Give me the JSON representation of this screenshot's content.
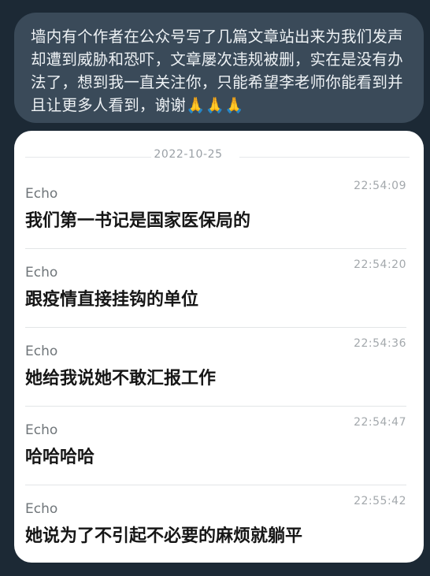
{
  "bubble": {
    "text": "墙内有个作者在公众号写了几篇文章站出来为我们发声却遭到威胁和恐吓，文章屡次违规被删，实在是没有办法了，想到我一直关注你，只能希望李老师你能看到并且让更多人看到，谢谢🙏🙏🙏"
  },
  "chat": {
    "date": "2022-10-25",
    "messages": [
      {
        "sender": "Echo",
        "time": "22:54:09",
        "text": "我们第一书记是国家医保局的"
      },
      {
        "sender": "Echo",
        "time": "22:54:20",
        "text": "跟疫情直接挂钩的单位"
      },
      {
        "sender": "Echo",
        "time": "22:54:36",
        "text": "她给我说她不敢汇报工作"
      },
      {
        "sender": "Echo",
        "time": "22:54:47",
        "text": "哈哈哈哈"
      },
      {
        "sender": "Echo",
        "time": "22:55:42",
        "text": "她说为了不引起不必要的麻烦就躺平"
      }
    ]
  },
  "colors": {
    "page_background": "#1c2935",
    "bubble_background": "#3a4a59",
    "card_background": "#ffffff"
  }
}
